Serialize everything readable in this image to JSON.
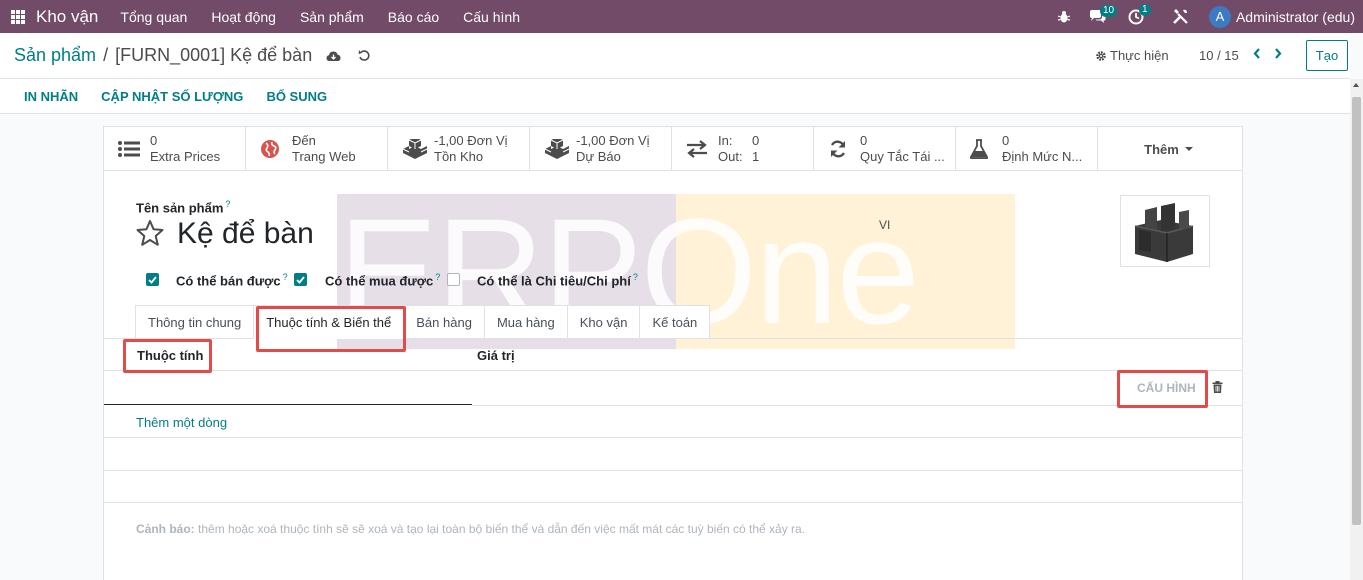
{
  "navbar": {
    "app_name": "Kho vận",
    "menu": [
      "Tổng quan",
      "Hoạt động",
      "Sản phẩm",
      "Báo cáo",
      "Cấu hình"
    ],
    "chat_badge": "10",
    "activity_badge": "1",
    "avatar_letter": "A",
    "user_name": "Administrator (edu)"
  },
  "control_panel": {
    "breadcrumb_parent": "Sản phẩm",
    "breadcrumb_separator": "/",
    "breadcrumb_current": "[FURN_0001] Kệ để bàn",
    "action_label": "Thực hiện",
    "pager": "10 / 15",
    "create_label": "Tạo"
  },
  "status_buttons": [
    "IN NHÃN",
    "CẬP NHẬT SỐ LƯỢNG",
    "BỔ SUNG"
  ],
  "smart_buttons": {
    "extra_prices": {
      "value": "0",
      "label": "Extra Prices"
    },
    "website": {
      "value": "Đến",
      "label": "Trang Web"
    },
    "on_hand": {
      "value": "-1,00 Đơn Vị",
      "label": "Tồn Kho"
    },
    "forecast": {
      "value": "-1,00 Đơn Vị",
      "label": "Dự Báo"
    },
    "in_out": {
      "in_label": "In:",
      "in_value": "0",
      "out_label": "Out:",
      "out_value": "1"
    },
    "reorder": {
      "value": "0",
      "label": "Quy Tắc Tái ..."
    },
    "bom": {
      "value": "0",
      "label": "Định Mức N..."
    },
    "more_label": "Thêm"
  },
  "watermark": {
    "text": "ERPOne"
  },
  "form": {
    "name_label": "Tên sản phẩm",
    "help_mark": "?",
    "product_name": "Kệ để bàn",
    "lang_code": "VI",
    "checkboxes": [
      {
        "label": "Có thể bán được",
        "checked": true
      },
      {
        "label": "Có thể mua được",
        "checked": true
      },
      {
        "label": "Có thể là Chi tiêu/Chi phí",
        "checked": false
      }
    ]
  },
  "tabs": [
    "Thông tin chung",
    "Thuộc tính & Biến thể",
    "Bán hàng",
    "Mua hàng",
    "Kho vận",
    "Kế toán"
  ],
  "active_tab": "Thuộc tính & Biến thể",
  "attributes_table": {
    "col_attribute": "Thuộc tính",
    "col_value": "Giá trị",
    "configure_label": "CẤU HÌNH",
    "add_line": "Thêm một dòng"
  },
  "warning": {
    "prefix": "Cảnh báo:",
    "text": " thêm hoặc xoá thuộc tính sẽ sẽ xoá và tạo lại toàn bộ biến thể và dẫn đến việc mất mát các tuỳ biến có thể xảy ra."
  },
  "colors": {
    "brand": "#714b67",
    "accent": "#017e84",
    "highlight": "#e34a4a"
  }
}
